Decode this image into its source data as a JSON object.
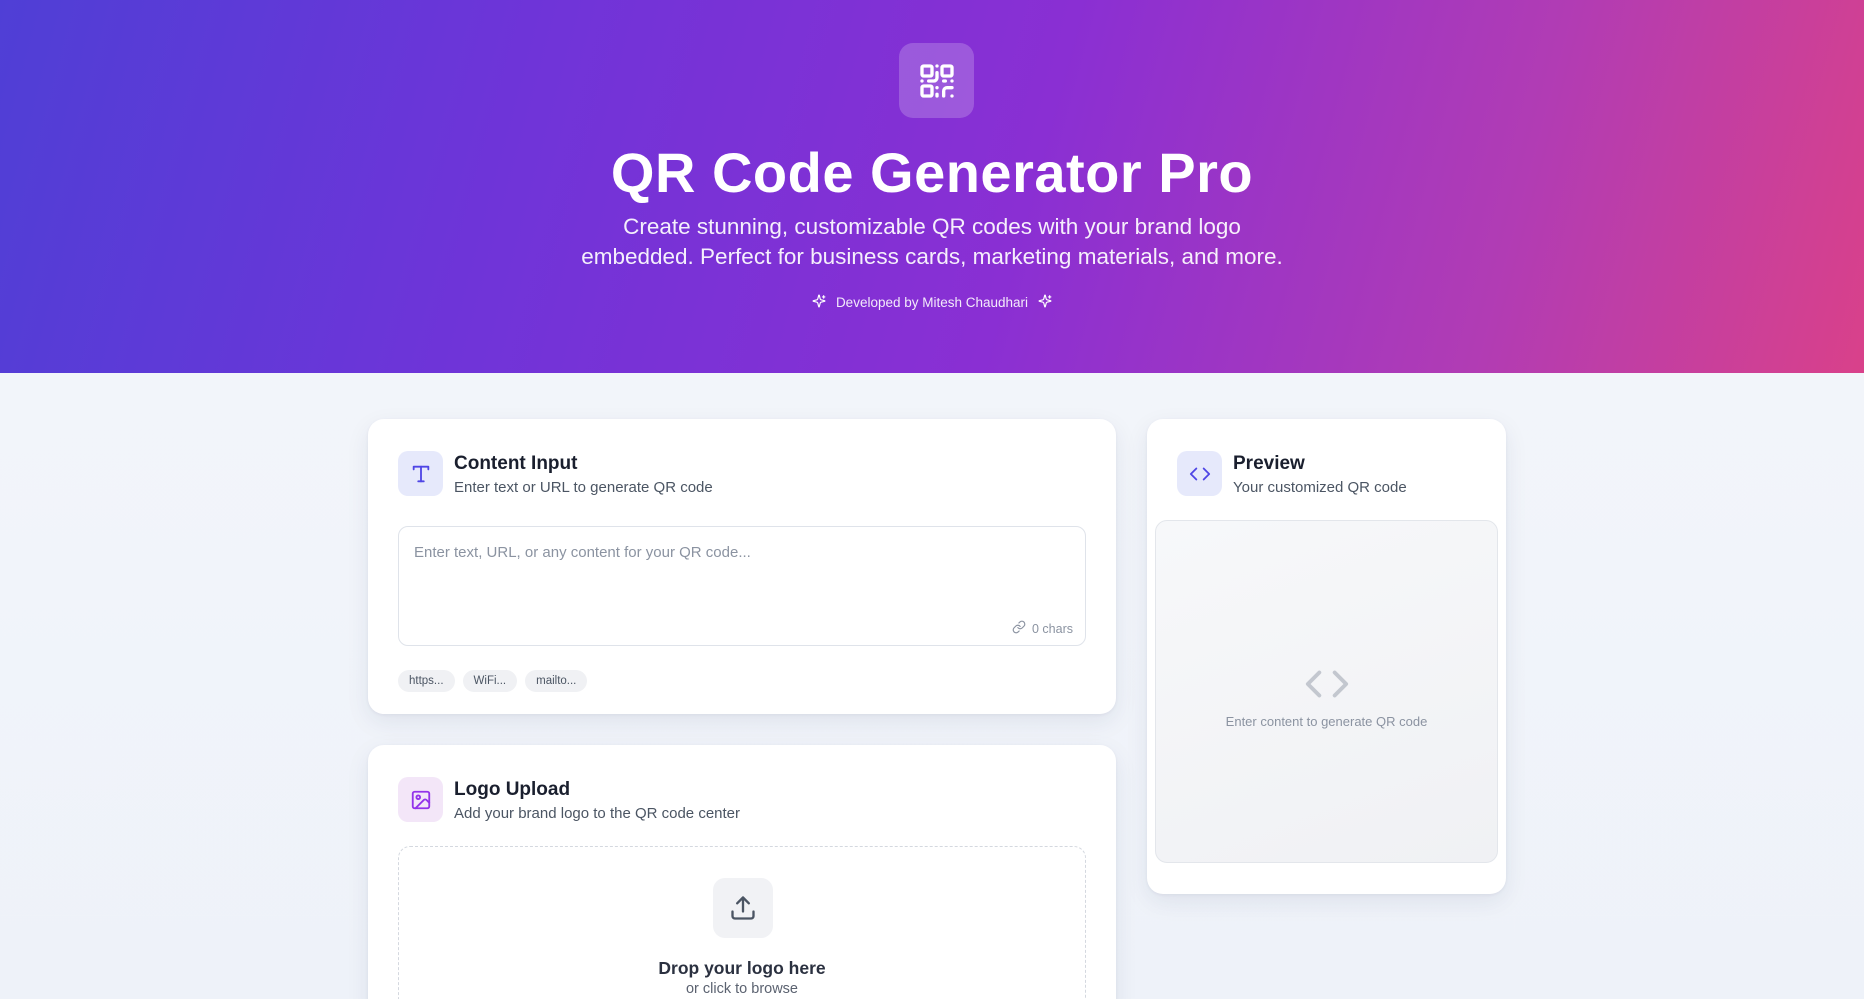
{
  "hero": {
    "logo_icon": "qr-code-icon",
    "title": "QR Code Generator Pro",
    "subtitle_line1": "Create stunning, customizable QR codes with your brand logo",
    "subtitle_line2": "embedded. Perfect for business cards, marketing materials, and more.",
    "developer": "Developed by Mitesh Chaudhari",
    "developer_icon": "sparkles-icon"
  },
  "content_input": {
    "icon": "type-icon",
    "title": "Content Input",
    "subtitle": "Enter text or URL to generate QR code",
    "placeholder": "Enter text, URL, or any content for your QR code...",
    "value": "",
    "char_count": "0 chars",
    "char_icon": "link-icon",
    "chips": [
      "https...",
      "WiFi...",
      "mailto..."
    ]
  },
  "logo_upload": {
    "icon": "image-icon",
    "title": "Logo Upload",
    "subtitle": "Add your brand logo to the QR code center",
    "upload_icon": "upload-icon",
    "drop_title": "Drop your logo here",
    "drop_sub": "or click to browse"
  },
  "preview": {
    "icon": "code-icon",
    "title": "Preview",
    "subtitle": "Your customized QR code",
    "empty_text": "Enter content to generate QR code"
  },
  "colors": {
    "accent_blue": "#4f46e5",
    "accent_purple": "#9333ea",
    "hero_start": "#4f3fd6",
    "hero_end": "#d9418a"
  }
}
